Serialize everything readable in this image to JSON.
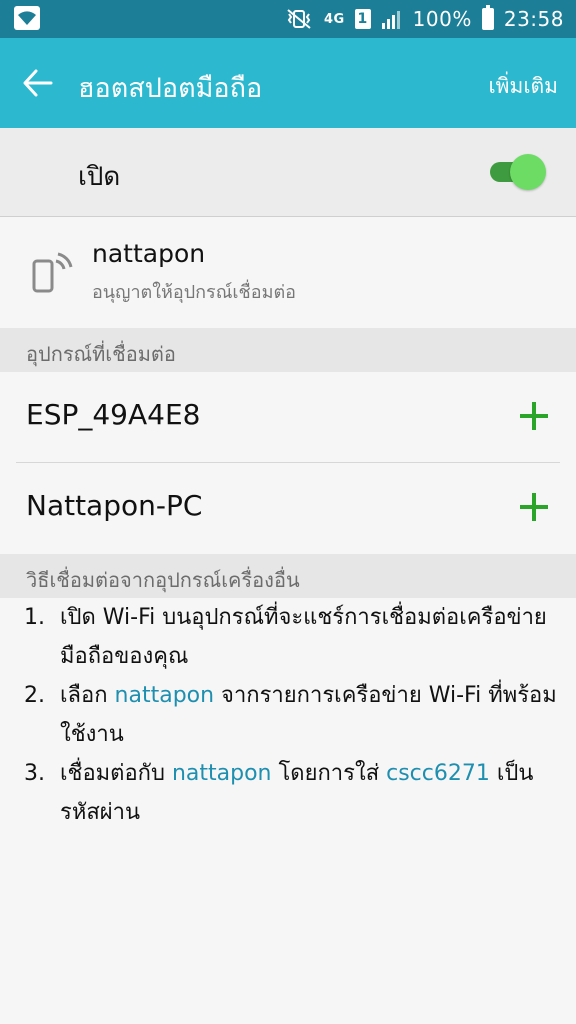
{
  "status_bar": {
    "wifi_icon": "wifi-icon",
    "mute_icon": "vibrate-mute-icon",
    "network_type": "4G",
    "sim_slot": "1",
    "battery_percent": "100%",
    "time": "23:58"
  },
  "app_bar": {
    "back_icon": "arrow-back-icon",
    "title": "ฮอตสปอตมือถือ",
    "more_label": "เพิ่มเติม"
  },
  "master_switch": {
    "label": "เปิด",
    "state": "on"
  },
  "hotspot": {
    "icon": "phone-hotspot-icon",
    "name": "nattapon",
    "subtitle": "อนุญาตให้อุปกรณ์เชื่อมต่อ"
  },
  "connected_section": {
    "header": "อุปกรณ์ที่เชื่อมต่อ",
    "devices": [
      {
        "name": "ESP_49A4E8",
        "action_icon": "plus-icon"
      },
      {
        "name": "Nattapon-PC",
        "action_icon": "plus-icon"
      }
    ]
  },
  "other_devices_section": {
    "header": "วิธีเชื่อมต่อจากอุปกรณ์เครื่องอื่น",
    "steps": [
      {
        "num": "1.",
        "text_a": "เปิด Wi-Fi บนอุปกรณ์ที่จะแชร์การเชื่อมต่อเครือข่ายมือถือของคุณ"
      },
      {
        "num": "2.",
        "text_a": "เลือก ",
        "highlight_a": "nattapon",
        "text_b": " จากรายการเครือข่าย Wi-Fi ที่พร้อมใช้งาน"
      },
      {
        "num": "3.",
        "text_a": "เชื่อมต่อกับ ",
        "highlight_a": "nattapon",
        "text_b": " โดยการใส่ ",
        "highlight_b": "cscc6271",
        "text_c": " เป็นรหัสผ่าน"
      }
    ]
  },
  "colors": {
    "status_bar": "#1c7f97",
    "app_bar": "#2cb8cf",
    "toggle_on": "#6cdc64",
    "plus": "#2aa52a",
    "highlight": "#1f8fb0"
  }
}
